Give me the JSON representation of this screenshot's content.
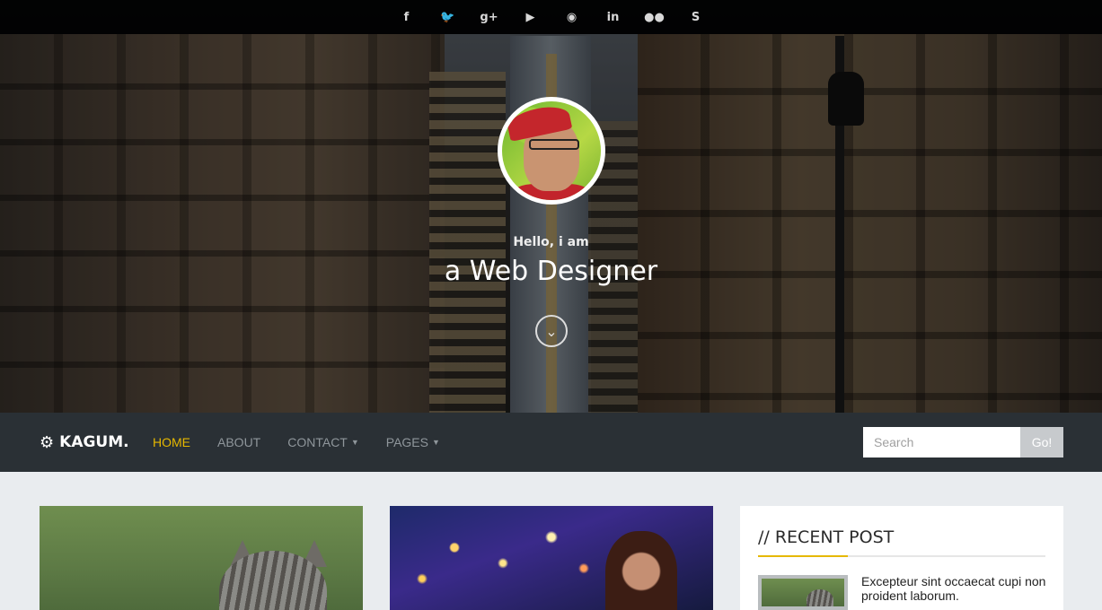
{
  "social": {
    "icons": [
      {
        "name": "facebook-icon",
        "glyph": "f"
      },
      {
        "name": "twitter-icon",
        "glyph": "🐦"
      },
      {
        "name": "google-plus-icon",
        "glyph": "g+"
      },
      {
        "name": "youtube-icon",
        "glyph": "▶"
      },
      {
        "name": "github-icon",
        "glyph": "◉"
      },
      {
        "name": "linkedin-icon",
        "glyph": "in"
      },
      {
        "name": "flickr-icon",
        "glyph": "●●"
      },
      {
        "name": "skype-icon",
        "glyph": "S"
      }
    ]
  },
  "hero": {
    "greeting": "Hello, i am",
    "role": "a Web Designer",
    "scroll_icon": "double-chevron-down-icon"
  },
  "navbar": {
    "brand": "KAGUM.",
    "brand_icon": "gear-icon",
    "items": [
      {
        "label": "HOME",
        "active": true,
        "dropdown": false
      },
      {
        "label": "ABOUT",
        "active": false,
        "dropdown": false
      },
      {
        "label": "CONTACT",
        "active": false,
        "dropdown": true
      },
      {
        "label": "PAGES",
        "active": false,
        "dropdown": true
      }
    ],
    "search_placeholder": "Search",
    "search_button": "Go!"
  },
  "sidebar": {
    "title": "// RECENT POST",
    "posts": [
      {
        "title": "Excepteur sint occaecat cupi non proident laborum."
      }
    ]
  },
  "colors": {
    "accent": "#e6b800",
    "navbar_bg": "#2a3035",
    "page_bg": "#e9ecef"
  }
}
